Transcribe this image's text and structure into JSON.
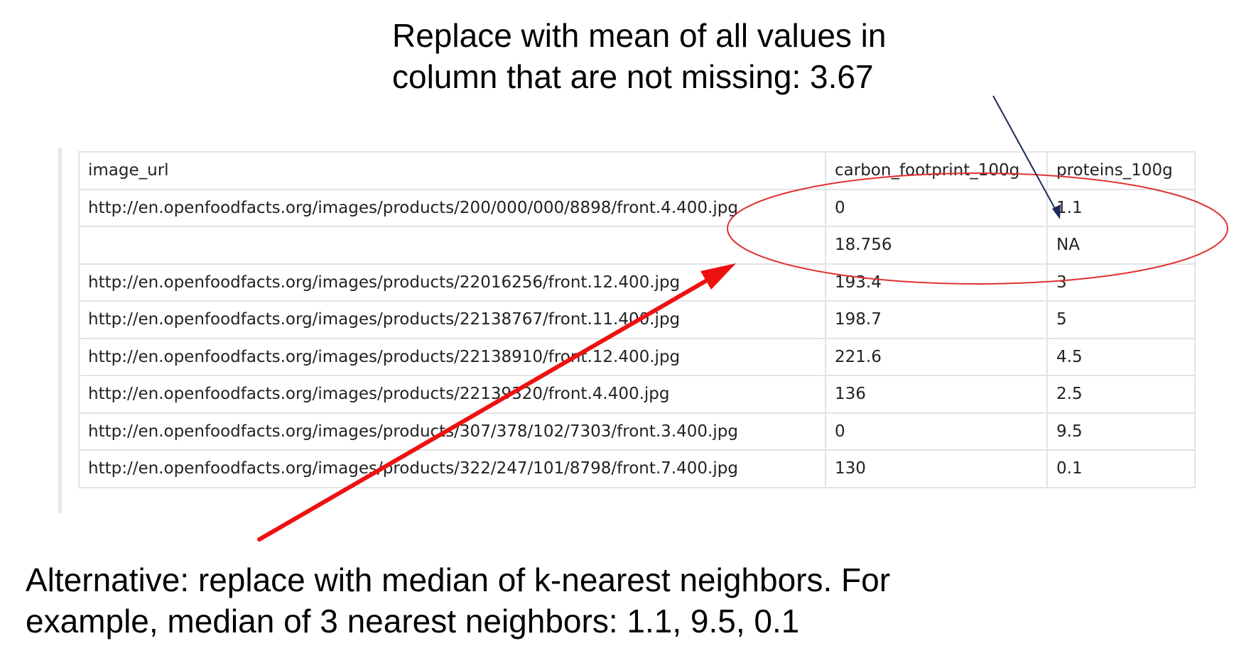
{
  "annotations": {
    "top_caption": [
      "Replace with mean of all values in",
      "column that are not missing: 3.67"
    ],
    "bottom_caption": [
      "Alternative: replace with median of k-nearest neighbors. For",
      "example, median of 3 nearest neighbors: 1.1, 9.5, 0.1"
    ]
  },
  "table": {
    "headers": [
      "image_url",
      "carbon_footprint_100g",
      "proteins_100g"
    ],
    "rows": [
      [
        "http://en.openfoodfacts.org/images/products/200/000/000/8898/front.4.400.jpg",
        "0",
        "1.1"
      ],
      [
        "",
        "18.756",
        "NA"
      ],
      [
        "http://en.openfoodfacts.org/images/products/22016256/front.12.400.jpg",
        "193.4",
        "3"
      ],
      [
        "http://en.openfoodfacts.org/images/products/22138767/front.11.400.jpg",
        "198.7",
        "5"
      ],
      [
        "http://en.openfoodfacts.org/images/products/22138910/front.12.400.jpg",
        "221.6",
        "4.5"
      ],
      [
        "http://en.openfoodfacts.org/images/products/22139320/front.4.400.jpg",
        "136",
        "2.5"
      ],
      [
        "http://en.openfoodfacts.org/images/products/307/378/102/7303/front.3.400.jpg",
        "0",
        "9.5"
      ],
      [
        "http://en.openfoodfacts.org/images/products/322/247/101/8798/front.7.400.jpg",
        "130",
        "0.1"
      ]
    ]
  },
  "colors": {
    "ellipse": "#e03030",
    "red_arrow": "#ee1111",
    "blue_arrow": "#1a2a5a"
  }
}
